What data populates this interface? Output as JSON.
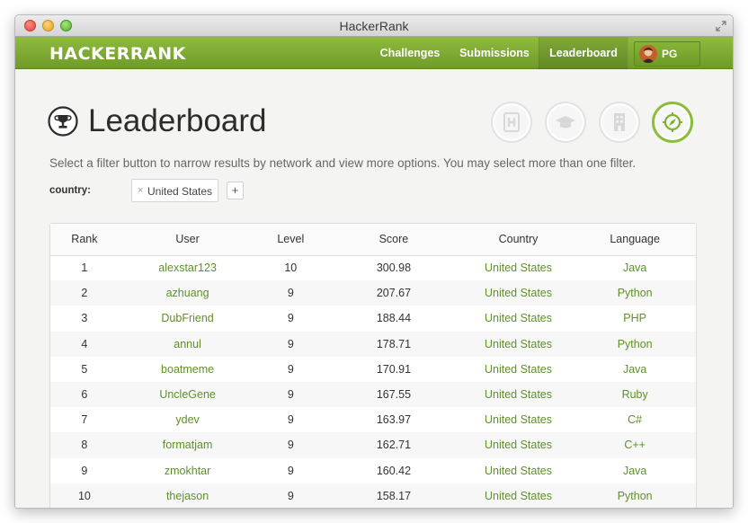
{
  "window": {
    "title": "HackerRank"
  },
  "nav": {
    "logo": "HACKERRANK",
    "items": [
      "Challenges",
      "Submissions",
      "Leaderboard"
    ],
    "user_initials": "PG"
  },
  "page": {
    "title": "Leaderboard",
    "instructions": "Select a filter button to narrow results by network and view more options. You may select more than one filter.",
    "filter_label": "country:",
    "filter_tag": "United States",
    "filter_remove": "×",
    "add_filter": "+"
  },
  "filters": [
    "hackerrank-icon",
    "graduation-cap-icon",
    "building-icon",
    "compass-icon"
  ],
  "table": {
    "headers": [
      "Rank",
      "User",
      "Level",
      "Score",
      "Country",
      "Language"
    ],
    "rows": [
      {
        "rank": "1",
        "user": "alexstar123",
        "level": "10",
        "score": "300.98",
        "country": "United States",
        "language": "Java"
      },
      {
        "rank": "2",
        "user": "azhuang",
        "level": "9",
        "score": "207.67",
        "country": "United States",
        "language": "Python"
      },
      {
        "rank": "3",
        "user": "DubFriend",
        "level": "9",
        "score": "188.44",
        "country": "United States",
        "language": "PHP"
      },
      {
        "rank": "4",
        "user": "annul",
        "level": "9",
        "score": "178.71",
        "country": "United States",
        "language": "Python"
      },
      {
        "rank": "5",
        "user": "boatmeme",
        "level": "9",
        "score": "170.91",
        "country": "United States",
        "language": "Java"
      },
      {
        "rank": "6",
        "user": "UncleGene",
        "level": "9",
        "score": "167.55",
        "country": "United States",
        "language": "Ruby"
      },
      {
        "rank": "7",
        "user": "ydev",
        "level": "9",
        "score": "163.97",
        "country": "United States",
        "language": "C#"
      },
      {
        "rank": "8",
        "user": "formatjam",
        "level": "9",
        "score": "162.71",
        "country": "United States",
        "language": "C++"
      },
      {
        "rank": "9",
        "user": "zmokhtar",
        "level": "9",
        "score": "160.42",
        "country": "United States",
        "language": "Java"
      },
      {
        "rank": "10",
        "user": "thejason",
        "level": "9",
        "score": "158.17",
        "country": "United States",
        "language": "Python"
      }
    ]
  },
  "colors": {
    "brand_green": "#7aa832",
    "link_green": "#5e9128",
    "active_filter": "#8bbd3a"
  }
}
